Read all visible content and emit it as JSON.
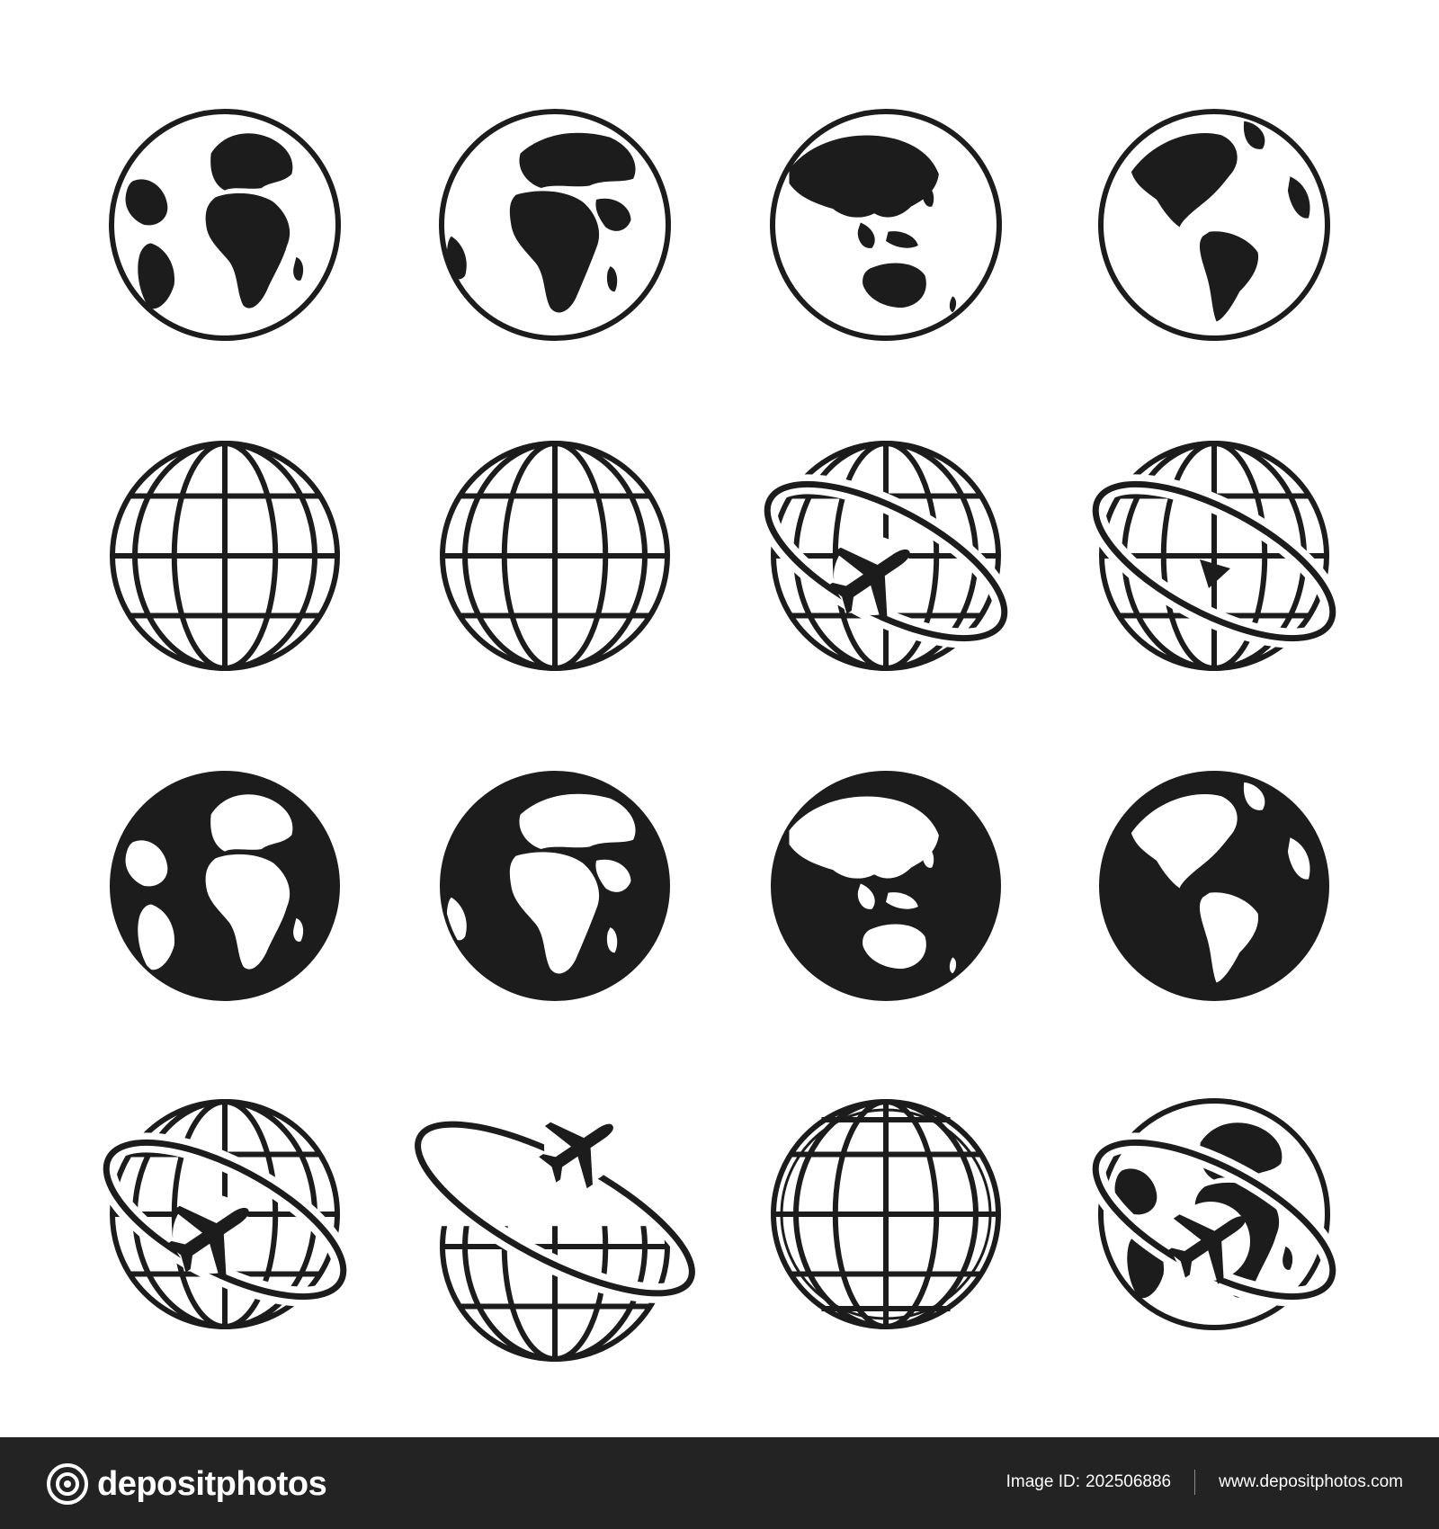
{
  "palette": {
    "ink": "#1c1c1c",
    "background": "#ffffff",
    "footer_bg": "#232323",
    "footer_text": "#ffffff"
  },
  "icon_grid": {
    "rows": [
      [
        "globe-outline-europe-africa",
        "globe-outline-africa-arabia",
        "globe-outline-asia-australia",
        "globe-outline-americas"
      ],
      [
        "wireframe-globe",
        "wireframe-globe",
        "wireframe-globe-airplane-orbit",
        "wireframe-globe-arrow-orbit"
      ],
      [
        "globe-solid-europe-africa",
        "globe-solid-africa-arabia",
        "globe-solid-asia-australia",
        "globe-solid-americas"
      ],
      [
        "wireframe-globe-airplane-orbit",
        "wireframe-globe-tilted-orbit-airplane",
        "wireframe-globe-outline",
        "globe-map-airplane-orbit"
      ]
    ]
  },
  "footer": {
    "logo_text": "depositphotos",
    "image_id_label": "Image ID:",
    "image_id_value": "202506886",
    "site_url": "www.depositphotos.com"
  }
}
